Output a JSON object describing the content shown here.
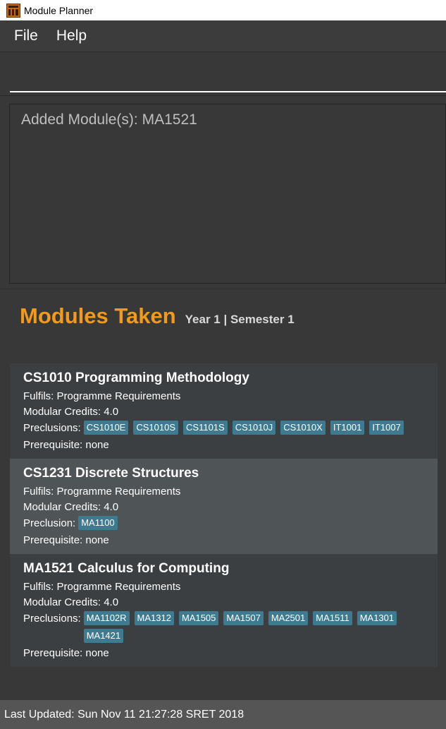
{
  "window": {
    "title": "Module Planner",
    "app_icon": "planner-app-icon"
  },
  "menu": {
    "items": [
      "File",
      "Help"
    ]
  },
  "command": {
    "value": "",
    "placeholder": ""
  },
  "result": {
    "message": "Added Module(s): MA1521"
  },
  "panel": {
    "title": "Modules Taken",
    "subtitle": "Year 1 | Semester 1"
  },
  "modules": [
    {
      "name": "CS1010 Programming Methodology",
      "fulfils": "Fulfils: Programme Requirements",
      "credits": "Modular Credits: 4.0",
      "preclusion_label": "Preclusions:",
      "preclusions": [
        "CS1010E",
        "CS1010S",
        "CS1101S",
        "CS1010J",
        "CS1010X",
        "IT1001",
        "IT1007"
      ],
      "prerequisite": "Prerequisite: none"
    },
    {
      "name": "CS1231 Discrete Structures",
      "fulfils": "Fulfils: Programme Requirements",
      "credits": "Modular Credits: 4.0",
      "preclusion_label": "Preclusion:",
      "preclusions": [
        "MA1100"
      ],
      "prerequisite": "Prerequisite: none"
    },
    {
      "name": "MA1521 Calculus for Computing",
      "fulfils": "Fulfils: Programme Requirements",
      "credits": "Modular Credits: 4.0",
      "preclusion_label": "Preclusions:",
      "preclusions": [
        "MA1102R",
        "MA1312",
        "MA1505",
        "MA1507",
        "MA2501",
        "MA1511",
        "MA1301",
        "MA1421"
      ],
      "prerequisite": "Prerequisite: none"
    }
  ],
  "status": {
    "text": "Last Updated: Sun Nov 11 21:27:28 SRET 2018"
  },
  "colors": {
    "accent": "#f29a1a",
    "tag": "#3e7b91",
    "selected": "#4f5557"
  }
}
